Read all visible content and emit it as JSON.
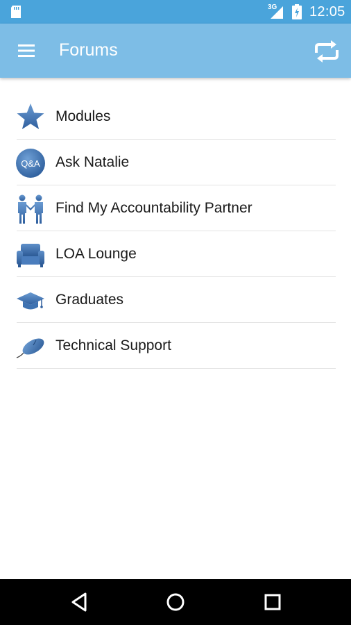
{
  "status_bar": {
    "network_label": "3G",
    "time": "12:05"
  },
  "app_bar": {
    "title": "Forums",
    "menu_icon": "hamburger-menu-icon",
    "refresh_icon": "repeat-arrows-icon",
    "background_color": "#7dbde6"
  },
  "forums": [
    {
      "label": "Modules",
      "icon": "star-icon"
    },
    {
      "label": "Ask Natalie",
      "icon": "qa-badge-icon",
      "icon_text": "Q&A"
    },
    {
      "label": "Find My Accountability Partner",
      "icon": "people-holding-hands-icon"
    },
    {
      "label": "LOA Lounge",
      "icon": "armchair-icon"
    },
    {
      "label": "Graduates",
      "icon": "graduation-cap-icon"
    },
    {
      "label": "Technical Support",
      "icon": "computer-mouse-icon"
    }
  ],
  "nav_bar": {
    "back_icon": "back-triangle-icon",
    "home_icon": "home-circle-icon",
    "recents_icon": "recents-square-icon"
  },
  "colors": {
    "status_bar": "#4aa4db",
    "icon_blue": "#3f78b5"
  }
}
